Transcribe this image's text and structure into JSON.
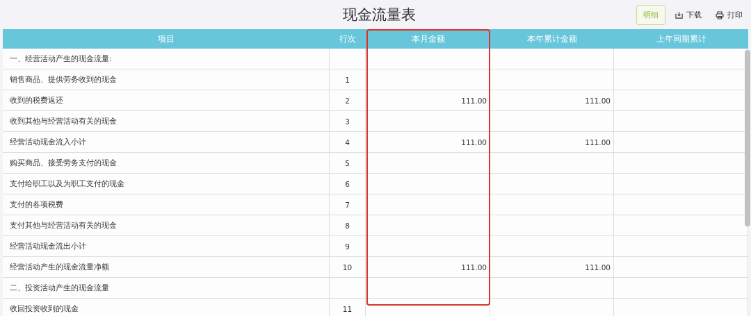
{
  "title": "现金流量表",
  "toolbar": [
    {
      "kind": "primary",
      "label": "明细"
    },
    {
      "kind": "download",
      "label": "下载"
    },
    {
      "kind": "print",
      "label": "打印"
    }
  ],
  "columns": [
    {
      "label": "项目",
      "highlighted": false
    },
    {
      "label": "行次",
      "highlighted": false
    },
    {
      "label": "本月金额",
      "highlighted": true
    },
    {
      "label": "本年累计金额",
      "highlighted": false
    },
    {
      "label": "上年同期累计",
      "highlighted": false
    }
  ],
  "rows": [
    {
      "item": "一、经营活动产生的现金流量:"
    },
    {
      "item": "销售商品、提供劳务收到的现金",
      "line": "1"
    },
    {
      "item": "收到的税费返还",
      "line": "2",
      "month": "111.00",
      "year": "111.00"
    },
    {
      "item": "收到其他与经营活动有关的现金",
      "line": "3"
    },
    {
      "item": "经营活动现金流入小计",
      "line": "4",
      "month": "111.00",
      "year": "111.00"
    },
    {
      "item": "购买商品、接受劳务支付的现金",
      "line": "5"
    },
    {
      "item": "支付给职工以及为职工支付的现金",
      "line": "6"
    },
    {
      "item": "支付的各项税费",
      "line": "7"
    },
    {
      "item": "支付其他与经营活动有关的现金",
      "line": "8"
    },
    {
      "item": "经营活动现金流出小计",
      "line": "9"
    },
    {
      "item": "经营活动产生的现金流量净额",
      "line": "10",
      "month": "111.00",
      "year": "111.00"
    },
    {
      "item": "二、投资活动产生的现金流量"
    },
    {
      "item": "收回投资收到的现金",
      "line": "11"
    }
  ]
}
